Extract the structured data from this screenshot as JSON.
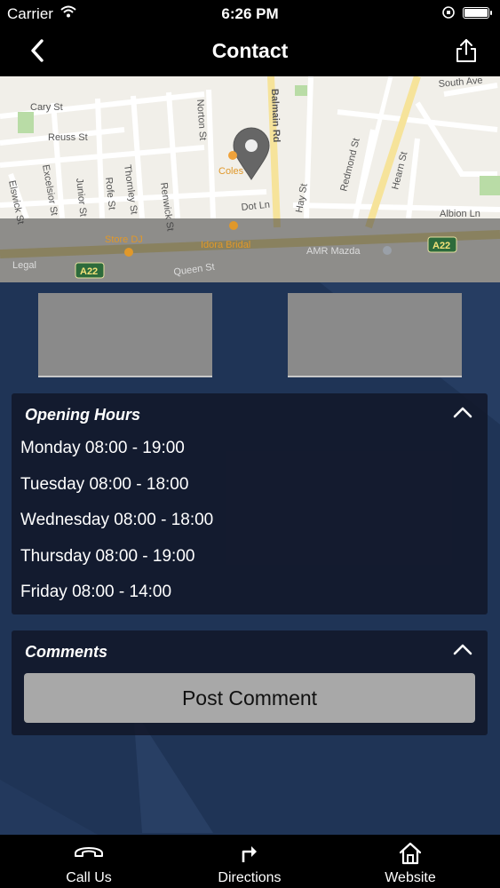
{
  "status": {
    "carrier": "Carrier",
    "time": "6:26 PM"
  },
  "nav": {
    "title": "Contact"
  },
  "map": {
    "streets": [
      "Cary St",
      "Reuss St",
      "Thornley St",
      "Renwick St",
      "Norton St",
      "Balmain Rd",
      "Junior St",
      "Excelsior St",
      "Elswick St",
      "Rofe St",
      "Dot Ln",
      "Hay St",
      "Redmond St",
      "Hearn St",
      "South Ave",
      "Albion Ln",
      "Queen St",
      "Legal"
    ],
    "places": [
      "Coles",
      "Store DJ",
      "Idora Bridal",
      "AMR Mazda"
    ],
    "road_badge": "A22"
  },
  "opening_hours": {
    "title": "Opening Hours",
    "days": [
      "Monday 08:00 - 19:00",
      "Tuesday 08:00 - 18:00",
      "Wednesday 08:00 - 18:00",
      "Thursday 08:00 - 19:00",
      "Friday 08:00 - 14:00"
    ]
  },
  "comments": {
    "title": "Comments",
    "post_label": "Post Comment"
  },
  "tabs": [
    {
      "label": "Call Us",
      "icon": "phone-icon"
    },
    {
      "label": "Directions",
      "icon": "directions-icon"
    },
    {
      "label": "Website",
      "icon": "home-icon"
    }
  ]
}
